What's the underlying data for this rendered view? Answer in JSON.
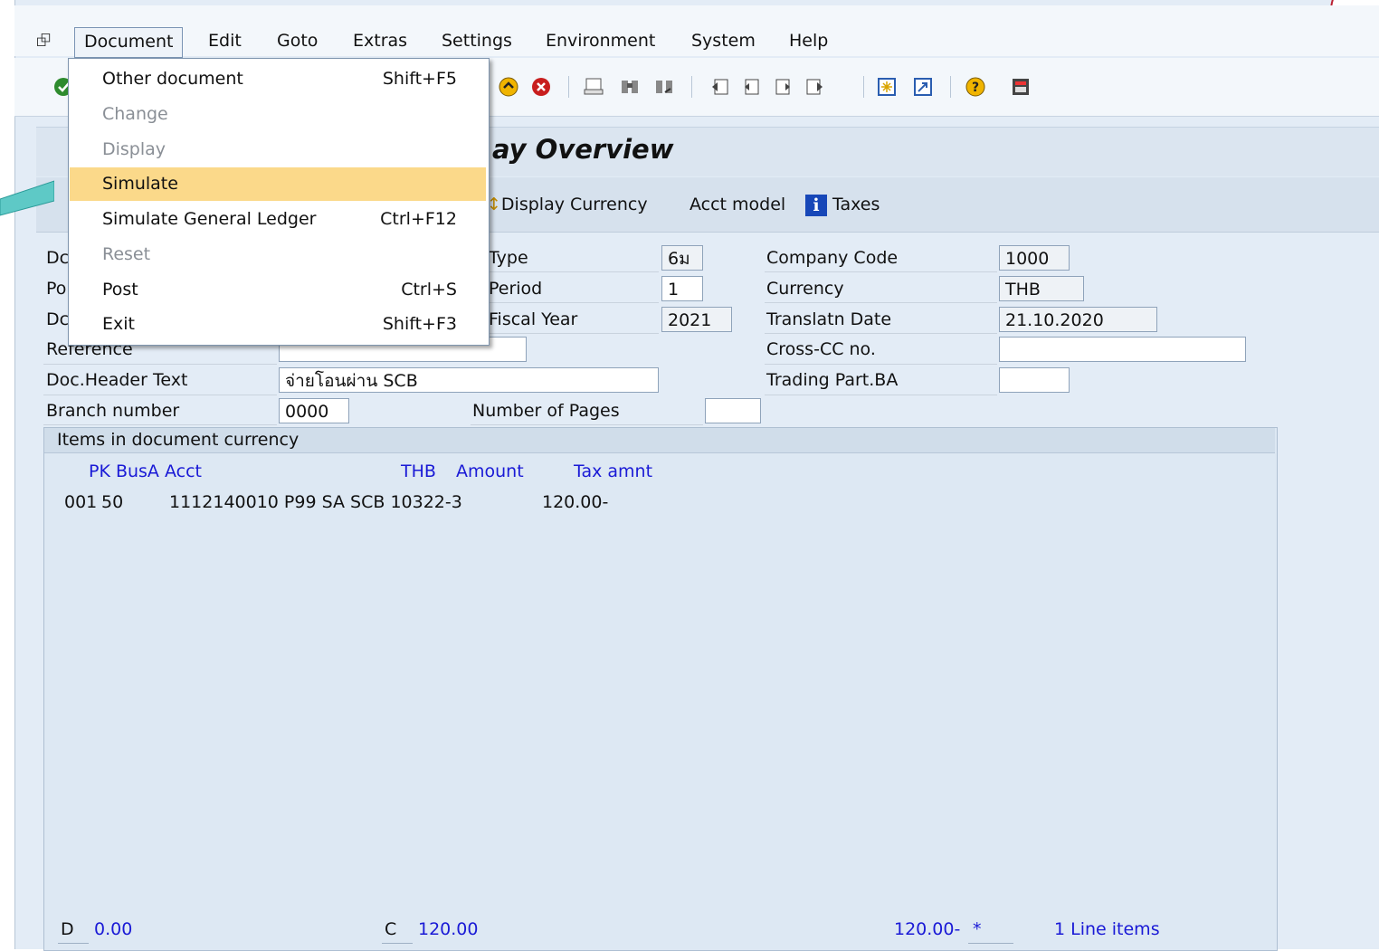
{
  "menubar": {
    "items": [
      {
        "label": "Document",
        "mnemonic": "D"
      },
      {
        "label": "Edit",
        "mnemonic": "E"
      },
      {
        "label": "Goto",
        "mnemonic": "G"
      },
      {
        "label": "Extras",
        "mnemonic": "a"
      },
      {
        "label": "Settings",
        "mnemonic": "S"
      },
      {
        "label": "Environment",
        "mnemonic": "v"
      },
      {
        "label": "System",
        "mnemonic": "y"
      },
      {
        "label": "Help",
        "mnemonic": "H"
      }
    ]
  },
  "toolbar": {
    "icons": [
      "enter-icon",
      "back-icon",
      "cancel-icon",
      "print-icon",
      "find-icon",
      "find-next-icon",
      "first-page-icon",
      "previous-page-icon",
      "next-page-icon",
      "last-page-icon",
      "create-session-icon",
      "shortcut-icon",
      "help-icon",
      "customize-layout-icon"
    ]
  },
  "title": "ay Overview",
  "appbar": {
    "display_currency": "Display Currency",
    "acct_model": "Acct model",
    "taxes": "Taxes"
  },
  "dropdown": {
    "items": [
      {
        "label": "Other document",
        "shortcut": "Shift+F5",
        "enabled": true
      },
      {
        "label": "Change",
        "shortcut": "",
        "enabled": false
      },
      {
        "label": "Display",
        "shortcut": "",
        "enabled": false
      },
      {
        "label": "Simulate",
        "shortcut": "",
        "enabled": true,
        "highlighted": true
      },
      {
        "label": "Simulate General Ledger",
        "shortcut": "Ctrl+F12",
        "enabled": true
      },
      {
        "label": "Reset",
        "shortcut": "",
        "enabled": false
      },
      {
        "label": "Post",
        "shortcut": "Ctrl+S",
        "enabled": true
      },
      {
        "label": "Exit",
        "shortcut": "Shift+F3",
        "enabled": true
      }
    ]
  },
  "header": {
    "left_labels": [
      "Dc",
      "Po",
      "Dc"
    ],
    "reference_label": "Reference",
    "reference_value": "",
    "doc_header_text_label": "Doc.Header Text",
    "doc_header_text_value": "จ่ายโอนผ่าน SCB",
    "branch_number_label": "Branch number",
    "branch_number_value": "0000",
    "number_of_pages_label": "Number of Pages",
    "number_of_pages_value": "",
    "type_label": "Type",
    "type_value": "6ม",
    "period_label": "Period",
    "period_value": "1",
    "fiscal_year_label": "Fiscal Year",
    "fiscal_year_value": "2021",
    "company_code_label": "Company Code",
    "company_code_value": "1000",
    "currency_label": "Currency",
    "currency_value": "THB",
    "translatn_date_label": "Translatn Date",
    "translatn_date_value": "21.10.2020",
    "cross_cc_label": "Cross-CC no.",
    "cross_cc_value": "",
    "trading_part_label": "Trading Part.BA",
    "trading_part_value": ""
  },
  "items": {
    "section_title": "Items in document currency",
    "columns": {
      "pk_busa_acct": "PK BusA Acct",
      "currency": "THB",
      "amount": "Amount",
      "tax_amount": "Tax amnt"
    },
    "rows": [
      {
        "item": "001",
        "pk": "50",
        "account_text": "1112140010 P99 SA SCB 10322-3",
        "amount": "120.00-"
      }
    ]
  },
  "footer": {
    "debit_label": "D",
    "debit_value": "0.00",
    "credit_label": "C",
    "credit_value": "120.00",
    "balance_value": "120.00-",
    "balance_flag": "*",
    "line_items": "1  Line items"
  }
}
